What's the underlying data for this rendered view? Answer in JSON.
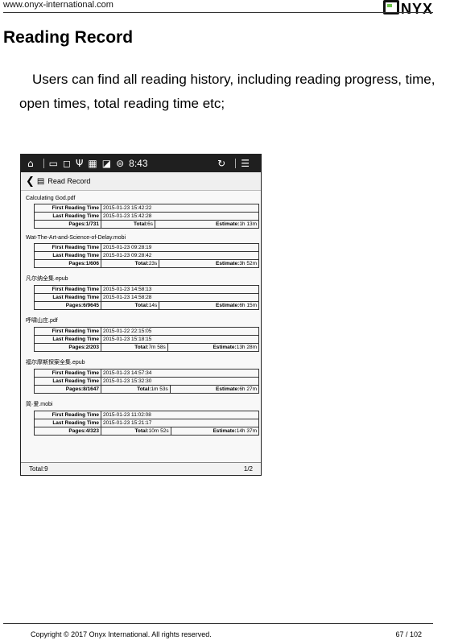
{
  "header": {
    "url": "www.onyx-international.com",
    "logo_text": "NYX"
  },
  "section": {
    "title": "Reading Record",
    "intro": "Users can find all reading history, including reading progress, time, open times, total reading time etc;"
  },
  "device": {
    "status_icons": [
      "home-icon",
      "battery-icon",
      "note-icon",
      "usb-icon",
      "cpu-icon",
      "image-icon",
      "wifi-icon",
      "refresh-icon",
      "menu-icon"
    ],
    "status_text": "8:43",
    "screen_title": "Read Record",
    "labels": {
      "first": "First Reading Time",
      "last": "Last Reading Time"
    },
    "records": [
      {
        "file": "Calculating God.pdf",
        "first": "2015-01-23 15:42:22",
        "last": "2015-01-23 15:42:28",
        "pages": "Pages:1/731",
        "total_label": "Total:",
        "total": "6s",
        "est_label": "Estimate:",
        "est": "1h 13m"
      },
      {
        "file": "Wat-The-Art-and-Science-of-Delay.mobi",
        "first": "2015-01-23 09:28:19",
        "last": "2015-01-23 09:28:42",
        "pages": "Pages:1/606",
        "total_label": "Total:",
        "total": "23s",
        "est_label": "Estimate:",
        "est": "3h 52m"
      },
      {
        "file": "凡尔纳全集.epub",
        "first": "2015-01-23 14:58:13",
        "last": "2015-01-23 14:58:28",
        "pages": "Pages:6/9645",
        "total_label": "Total:",
        "total": "14s",
        "est_label": "Estimate:",
        "est": "6h 15m"
      },
      {
        "file": "呼啸山庄.pdf",
        "first": "2015-01-22 22:15:05",
        "last": "2015-01-23 15:18:15",
        "pages": "Pages:2/203",
        "total_label": "Total:",
        "total": "7m 58s",
        "est_label": "Estimate:",
        "est": "13h 28m"
      },
      {
        "file": "福尔摩斯探案全集.epub",
        "first": "2015-01-23 14:57:34",
        "last": "2015-01-23 15:32:30",
        "pages": "Pages:8/1647",
        "total_label": "Total:",
        "total": "1m 53s",
        "est_label": "Estimate:",
        "est": "6h 27m"
      },
      {
        "file": "简·爱.mobi",
        "first": "2015-01-23 11:02:08",
        "last": "2015-01-23 15:21:17",
        "pages": "Pages:4/323",
        "total_label": "Total:",
        "total": "10m 52s",
        "est_label": "Estimate:",
        "est": "14h 37m"
      }
    ],
    "footer_total": "Total:9",
    "footer_page": "1/2"
  },
  "footer": {
    "copyright": "Copyright © 2017 Onyx International. All rights reserved.",
    "page": "67 / 102"
  }
}
